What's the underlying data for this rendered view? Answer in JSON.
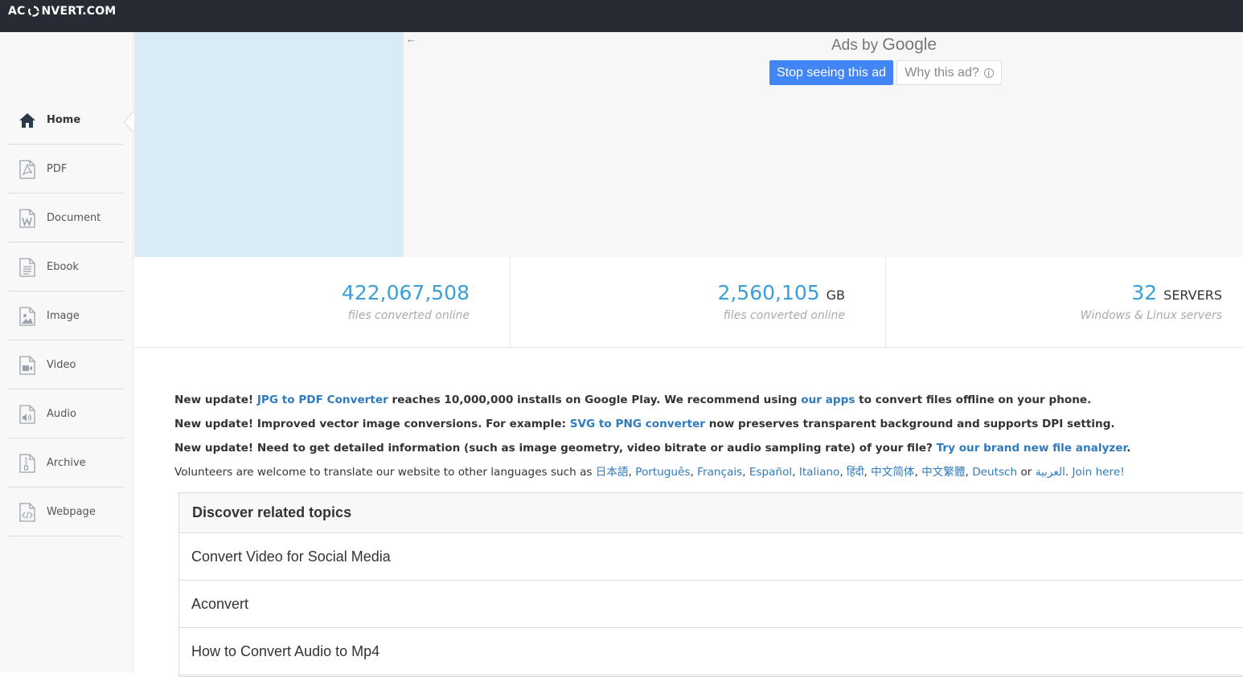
{
  "header": {
    "logo_left": "AC",
    "logo_right": "NVERT.COM"
  },
  "sidebar": {
    "items": [
      {
        "label": "Home",
        "icon": "home-icon",
        "active": true
      },
      {
        "label": "PDF",
        "icon": "pdf-file-icon"
      },
      {
        "label": "Document",
        "icon": "document-file-icon"
      },
      {
        "label": "Ebook",
        "icon": "ebook-file-icon"
      },
      {
        "label": "Image",
        "icon": "image-file-icon"
      },
      {
        "label": "Video",
        "icon": "video-file-icon"
      },
      {
        "label": "Audio",
        "icon": "audio-file-icon"
      },
      {
        "label": "Archive",
        "icon": "archive-file-icon"
      },
      {
        "label": "Webpage",
        "icon": "webpage-file-icon"
      }
    ]
  },
  "ad": {
    "back_arrow": "←",
    "ads_by": "Ads by",
    "google": "Google",
    "stop_label": "Stop seeing this ad",
    "why_label": "Why this ad?",
    "info_glyph": "i",
    "colors": {
      "placeholder": "#d9ebf6",
      "button": "#4285f4"
    }
  },
  "stats": [
    {
      "value": "422,067,508",
      "unit": "",
      "caption": "files converted online"
    },
    {
      "value": "2,560,105",
      "unit": "GB",
      "caption": "files converted online"
    },
    {
      "value": "32",
      "unit": "SERVERS",
      "caption": "Windows & Linux servers"
    }
  ],
  "news": {
    "line1": {
      "prefix": "New update! ",
      "link1": "JPG to PDF Converter",
      "mid": " reaches 10,000,000 installs on Google Play. We recommend using ",
      "link2": "our apps",
      "suffix": " to convert files offline on your phone."
    },
    "line2": {
      "prefix": "New update! Improved vector image conversions. For example: ",
      "link": "SVG to PNG converter",
      "suffix": " now preserves transparent background and supports DPI setting."
    },
    "line3": {
      "prefix": "New update! Need to get detailed information (such as image geometry, video bitrate or audio sampling rate) of your file? ",
      "link": "Try our brand new file analyzer",
      "suffix": "."
    },
    "line4": {
      "prefix": "Volunteers are welcome to translate our website to other languages such as ",
      "languages": [
        "日本語",
        "Português",
        "Français",
        "Español",
        "Italiano",
        "हिंदी",
        "中文简体",
        "中文繁體",
        "Deutsch"
      ],
      "or": " or ",
      "last_language": "العربية",
      "join": "Join here!"
    }
  },
  "topics": {
    "title": "Discover related topics",
    "items": [
      "Convert Video for Social Media",
      "Aconvert",
      "How to Convert Audio to Mp4"
    ]
  },
  "colors": {
    "accent": "#3a9fd8",
    "link": "#2f7bbf",
    "topbar": "#272b33"
  }
}
